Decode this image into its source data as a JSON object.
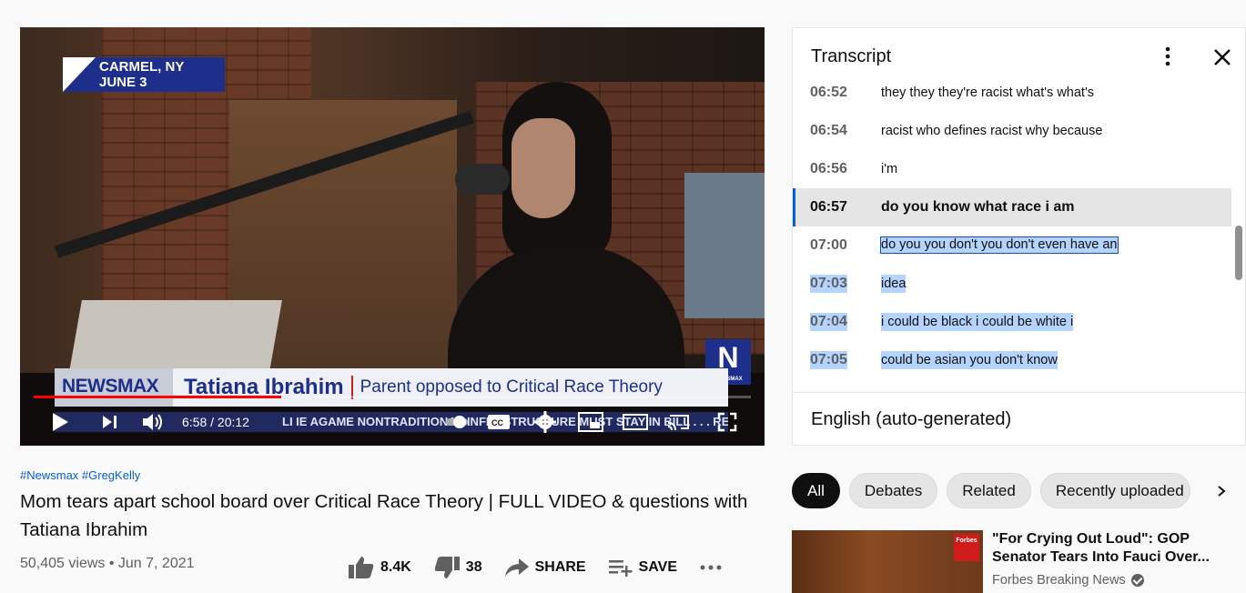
{
  "player": {
    "location_line1": "CARMEL, NY",
    "location_line2": "JUNE 3",
    "lower_third_brand": "NEWSMAX",
    "lower_third_name": "Tatiana Ibrahim",
    "lower_third_desc": "Parent opposed to Critical Race Theory",
    "ticker_text": "LI  IE  AGAME NONTRADITIONAL INFRASTRUCTURE MUST STAY IN BILL . . .  REP. BL",
    "corner_logo": "N",
    "corner_logo_sub": "NEWSMAX",
    "time_current": "6:58",
    "time_total": "20:12",
    "time_separator": " / ",
    "progress_fraction": 0.345,
    "accent_color": "#ff0000"
  },
  "video": {
    "hashtags": "#Newsmax #GregKelly",
    "title": "Mom tears apart school board over Critical Race Theory | FULL VIDEO & questions with Tatiana Ibrahim",
    "views_date": "50,405 views • Jun 7, 2021",
    "likes": "8.4K",
    "dislikes": "38",
    "share_label": "SHARE",
    "save_label": "SAVE"
  },
  "transcript": {
    "title": "Transcript",
    "language": "English (auto-generated)",
    "segments": [
      {
        "time": "06:52",
        "text": "they they they're racist what's what's"
      },
      {
        "time": "06:54",
        "text": "racist who defines racist why because"
      },
      {
        "time": "06:56",
        "text": "i'm"
      },
      {
        "time": "06:57",
        "text": "do you know what race i am"
      },
      {
        "time": "07:00",
        "text": "do you you don't you don't even have an"
      },
      {
        "time": "07:03",
        "text": "idea"
      },
      {
        "time": "07:04",
        "text": "i could be black i could be white i"
      },
      {
        "time": "07:05",
        "text": "could be asian you don't know"
      }
    ]
  },
  "chips": [
    "All",
    "Debates",
    "Related",
    "Recently uploaded"
  ],
  "recommended": {
    "title": "\"For Crying Out Loud\": GOP Senator Tears Into Fauci Over...",
    "channel": "Forbes Breaking News",
    "thumb_badge": "Forbes"
  }
}
